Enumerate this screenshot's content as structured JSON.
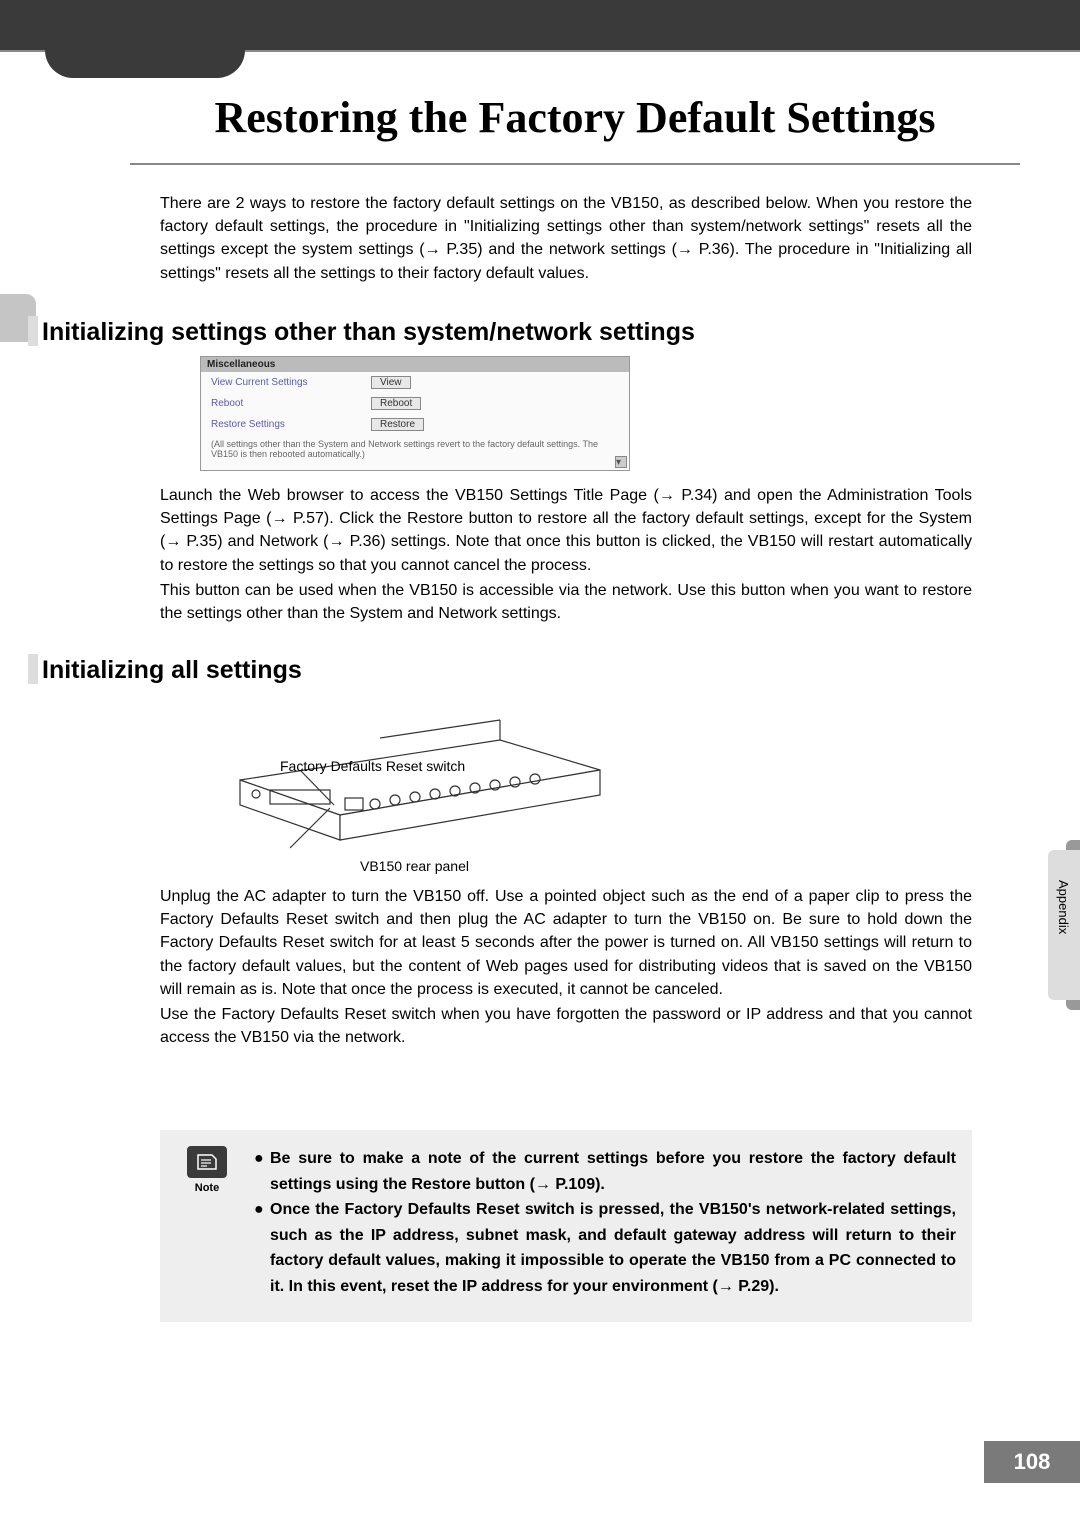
{
  "page_title": "Restoring the Factory Default Settings",
  "intro": "There are 2 ways to restore the factory default settings on the VB150, as described below. When you restore the factory default settings, the procedure in \"Initializing settings other than system/network settings\" resets all the settings except the system settings (→ P.35) and the network settings (→ P.36). The procedure in \"Initializing all settings\" resets all the settings to their factory default values.",
  "section1": {
    "heading": "Initializing settings other than system/network settings",
    "screenshot": {
      "header": "Miscellaneous",
      "rows": [
        {
          "label": "View Current Settings",
          "button": "View"
        },
        {
          "label": "Reboot",
          "button": "Reboot"
        },
        {
          "label": "Restore Settings",
          "button": "Restore"
        }
      ],
      "footnote": "(All settings other than the System and Network settings revert to the factory default settings. The VB150 is then rebooted automatically.)"
    },
    "para_a": "Launch the Web browser to access the VB150 Settings Title Page (→ P.34) and open the Administration Tools Settings Page (→ P.57). Click the Restore button to restore all the factory default settings, except for the System (→ P.35) and Network (→ P.36) settings. Note that once this button is clicked, the VB150 will restart automatically to restore the settings so that you cannot cancel the process.",
    "para_b": "This button can be used when the VB150 is accessible via the network. Use this button when you want to restore the settings other than the System and Network settings."
  },
  "section2": {
    "heading": "Initializing all settings",
    "diagram_label": "Factory Defaults Reset switch",
    "diagram_caption": "VB150 rear panel",
    "para_a": "Unplug the AC adapter to turn the VB150 off. Use a pointed object such as the end of a paper clip to press the Factory Defaults Reset switch and then plug the AC adapter to turn the VB150 on. Be sure to hold down the Factory Defaults Reset switch for at least 5 seconds after the power is turned on. All VB150 settings will return to the factory default values, but the content of Web pages used for distributing videos that is saved on the VB150 will remain as is. Note that once the process is executed, it cannot be canceled.",
    "para_b": "Use the Factory Defaults Reset switch when you have forgotten the password or IP address and that you cannot access the VB150 via the network."
  },
  "note": {
    "label": "Note",
    "bullet1": "Be sure to make a note of the current settings before you restore the factory default settings using the Restore button (→ P.109).",
    "bullet2": "Once the Factory Defaults Reset switch is pressed, the VB150's network-related settings, such as the IP address, subnet mask, and default gateway address will return to their factory default values, making it impossible to operate the VB150 from a PC connected to it. In this event, reset the IP address for your environment (→ P.29)."
  },
  "side_tab": "Appendix",
  "page_number": "108"
}
